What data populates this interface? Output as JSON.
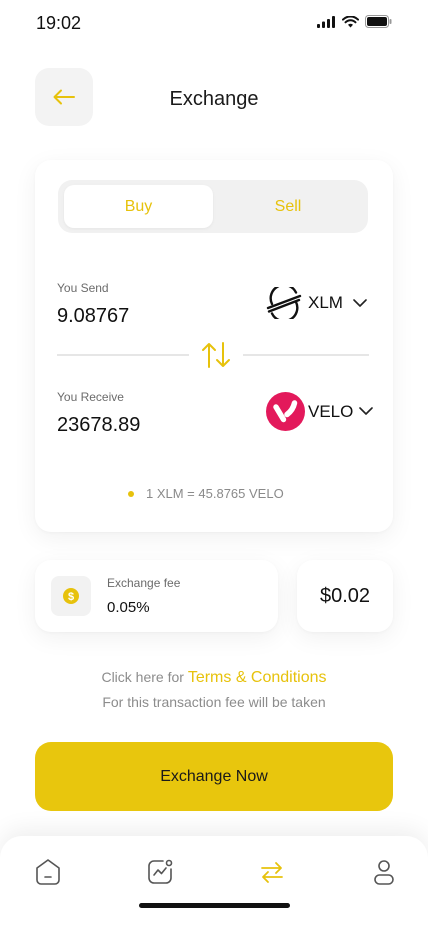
{
  "status_bar": {
    "time": "19:02"
  },
  "header": {
    "title": "Exchange"
  },
  "toggle": {
    "buy_label": "Buy",
    "sell_label": "Sell",
    "selected": "Buy"
  },
  "send": {
    "label": "You Send",
    "amount": "9.08767",
    "coin": "XLM",
    "coin_icon": "stellar-icon"
  },
  "receive": {
    "label": "You Receive",
    "amount": "23678.89",
    "coin": "VELO",
    "coin_icon": "velo-icon"
  },
  "rate": {
    "text": "1 XLM = 45.8765 VELO"
  },
  "fee": {
    "label": "Exchange fee",
    "value": "0.05%",
    "amount": "$0.02",
    "icon": "dollar-coin-icon"
  },
  "terms": {
    "prefix": "Click here for",
    "link": "Terms & Conditions",
    "note": "For this transaction fee will be taken"
  },
  "primary_action": {
    "label": "Exchange Now"
  },
  "nav": {
    "items": [
      {
        "icon": "home-icon",
        "active": false
      },
      {
        "icon": "chart-icon",
        "active": false
      },
      {
        "icon": "exchange-icon",
        "active": true
      },
      {
        "icon": "profile-icon",
        "active": false
      }
    ]
  },
  "colors": {
    "accent": "#E8C60D",
    "velo": "#E3195B",
    "muted": "#8C8C8C"
  }
}
